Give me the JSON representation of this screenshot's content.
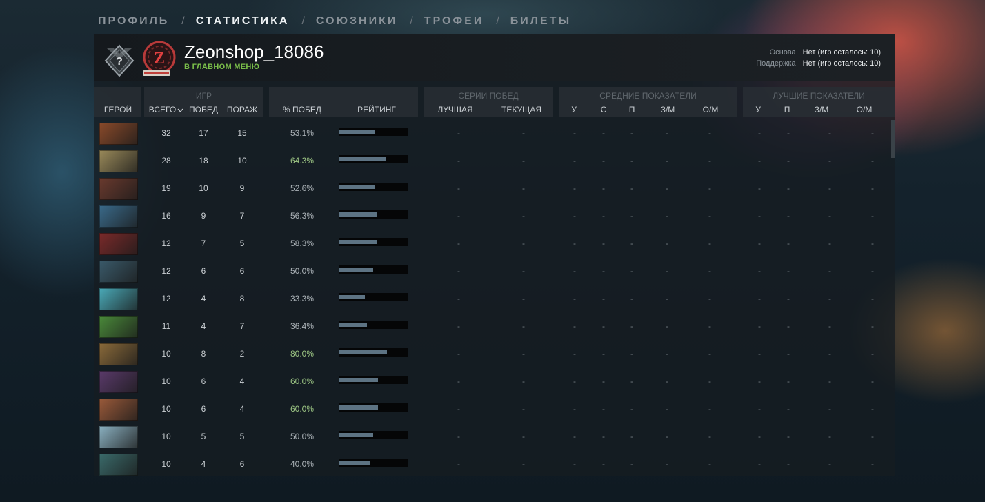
{
  "nav": {
    "tabs": [
      {
        "label": "ПРОФИЛЬ",
        "active": false
      },
      {
        "label": "СТАТИСТИКА",
        "active": true
      },
      {
        "label": "СОЮЗНИКИ",
        "active": false
      },
      {
        "label": "ТРОФЕИ",
        "active": false
      },
      {
        "label": "БИЛЕТЫ",
        "active": false
      }
    ],
    "separator": "/"
  },
  "player": {
    "name": "Zeonshop_18086",
    "status": "В ГЛАВНОМ МЕНЮ",
    "avatar_letter": "Z",
    "rank_glyph": "?"
  },
  "calibration": [
    {
      "label": "Основа",
      "value": "Нет (игр осталось: 10)"
    },
    {
      "label": "Поддержка",
      "value": "Нет (игр осталось: 10)"
    }
  ],
  "columns": {
    "hero": "ГЕРОЙ",
    "games_group": "ИГР",
    "total": "ВСЕГО",
    "wins": "ПОБЕД",
    "losses": "ПОРАЖ",
    "winrate": "% ПОБЕД",
    "rating": "РЕЙТИНГ",
    "streaks_group": "СЕРИИ ПОБЕД",
    "best": "ЛУЧШАЯ",
    "current": "ТЕКУЩАЯ",
    "avg_group": "СРЕДНИЕ ПОКАЗАТЕЛИ",
    "avg_cols": [
      "У",
      "С",
      "П",
      "З/М",
      "О/М"
    ],
    "best_group": "ЛУЧШИЕ ПОКАЗАТЕЛИ",
    "best_cols": [
      "У",
      "П",
      "З/М",
      "О/М"
    ]
  },
  "rows": [
    {
      "total": "32",
      "wins": "17",
      "losses": "15",
      "winrate": "53.1%",
      "rating": 0.53,
      "color": "#8a4a2a"
    },
    {
      "total": "28",
      "wins": "18",
      "losses": "10",
      "winrate": "64.3%",
      "rating": 0.68,
      "color": "#9a8a5a"
    },
    {
      "total": "19",
      "wins": "10",
      "losses": "9",
      "winrate": "52.6%",
      "rating": 0.53,
      "color": "#6a3a2e"
    },
    {
      "total": "16",
      "wins": "9",
      "losses": "7",
      "winrate": "56.3%",
      "rating": 0.55,
      "color": "#3a6a8a"
    },
    {
      "total": "12",
      "wins": "7",
      "losses": "5",
      "winrate": "58.3%",
      "rating": 0.56,
      "color": "#7a2a2a"
    },
    {
      "total": "12",
      "wins": "6",
      "losses": "6",
      "winrate": "50.0%",
      "rating": 0.5,
      "color": "#3a5a6a"
    },
    {
      "total": "12",
      "wins": "4",
      "losses": "8",
      "winrate": "33.3%",
      "rating": 0.38,
      "color": "#4aaab8"
    },
    {
      "total": "11",
      "wins": "4",
      "losses": "7",
      "winrate": "36.4%",
      "rating": 0.41,
      "color": "#4a8a3a"
    },
    {
      "total": "10",
      "wins": "8",
      "losses": "2",
      "winrate": "80.0%",
      "rating": 0.7,
      "color": "#8a6a3a"
    },
    {
      "total": "10",
      "wins": "6",
      "losses": "4",
      "winrate": "60.0%",
      "rating": 0.57,
      "color": "#5a3a6a"
    },
    {
      "total": "10",
      "wins": "6",
      "losses": "4",
      "winrate": "60.0%",
      "rating": 0.57,
      "color": "#9a5a3a"
    },
    {
      "total": "10",
      "wins": "5",
      "losses": "5",
      "winrate": "50.0%",
      "rating": 0.5,
      "color": "#8ab0c0"
    },
    {
      "total": "10",
      "wins": "4",
      "losses": "6",
      "winrate": "40.0%",
      "rating": 0.45,
      "color": "#3a6a6a"
    }
  ],
  "empty_value": "-"
}
